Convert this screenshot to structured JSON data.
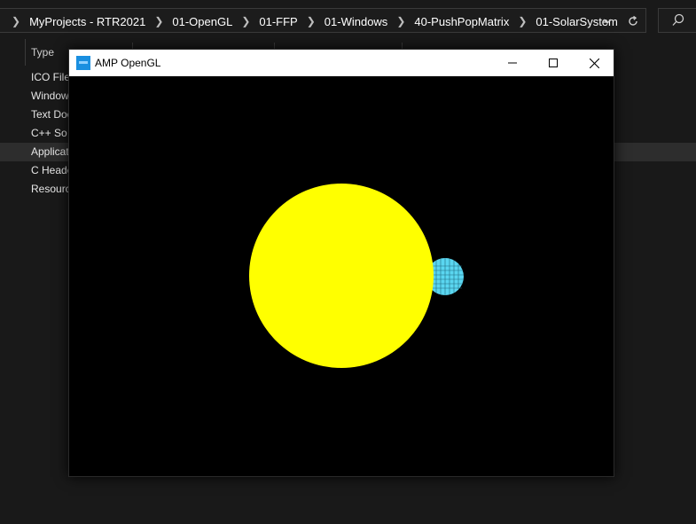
{
  "explorer": {
    "breadcrumbs": [
      "MyProjects - RTR2021",
      "01-OpenGL",
      "01-FFP",
      "01-Windows",
      "40-PushPopMatrix",
      "01-SolarSystem"
    ],
    "column_header": "Type",
    "rows": [
      "ICO File",
      "Window",
      "Text Doc",
      "C++ So",
      "Applicat",
      "C Heade",
      "Resource"
    ],
    "selected_row_index": 4
  },
  "gl_window": {
    "title": "AMP OpenGL",
    "scene": {
      "sun_color": "#ffff00",
      "planet_color": "#5ad6f0",
      "background": "#000000"
    }
  }
}
